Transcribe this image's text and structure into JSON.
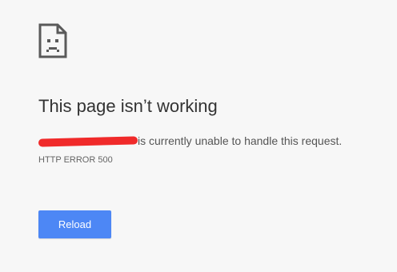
{
  "error_page": {
    "icon": "sad-page-icon",
    "title": "This page isn’t working",
    "message_suffix": "is currently unable to handle this request.",
    "error_code": "HTTP ERROR 500",
    "reload_label": "Reload"
  },
  "colors": {
    "background": "#f7f7f7",
    "button": "#4d87f5",
    "redaction": "#f02a2a"
  }
}
